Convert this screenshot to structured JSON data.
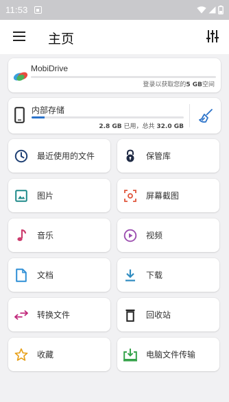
{
  "status_bar": {
    "time": "11:53"
  },
  "app_bar": {
    "title": "主页"
  },
  "mobidrive": {
    "name": "MobiDrive",
    "hint_prefix": "登录以获取您的",
    "hint_size": "5 GB",
    "hint_suffix": "空间"
  },
  "internal_storage": {
    "name": "内部存储",
    "used": "2.8 GB",
    "used_label": "已用，总共",
    "total": "32.0 GB",
    "used_fraction": 0.0875
  },
  "tiles": [
    {
      "label": "最近使用的文件",
      "icon": "clock-icon"
    },
    {
      "label": "保管库",
      "icon": "lock-icon"
    },
    {
      "label": "图片",
      "icon": "image-icon"
    },
    {
      "label": "屏幕截图",
      "icon": "screenshot-icon"
    },
    {
      "label": "音乐",
      "icon": "music-note-icon"
    },
    {
      "label": "视频",
      "icon": "play-circle-icon"
    },
    {
      "label": "文档",
      "icon": "document-icon"
    },
    {
      "label": "下载",
      "icon": "download-icon"
    },
    {
      "label": "转换文件",
      "icon": "convert-arrows-icon"
    },
    {
      "label": "回收站",
      "icon": "trash-icon"
    },
    {
      "label": "收藏",
      "icon": "star-icon"
    },
    {
      "label": "电脑文件传输",
      "icon": "pc-transfer-icon"
    }
  ],
  "colors": {
    "accent_blue": "#2a72c9",
    "clock": "#1e3f73",
    "lock": "#1f2a44",
    "image": "#1e8a8a",
    "screenshot": "#e0553b",
    "music": "#cc3d6e",
    "video": "#9c4fb0",
    "document": "#2f8fd6",
    "download": "#2e8bc0",
    "convert": "#c0267a",
    "trash": "#222222",
    "star": "#e8a11c",
    "pc_transfer": "#35a34a"
  }
}
